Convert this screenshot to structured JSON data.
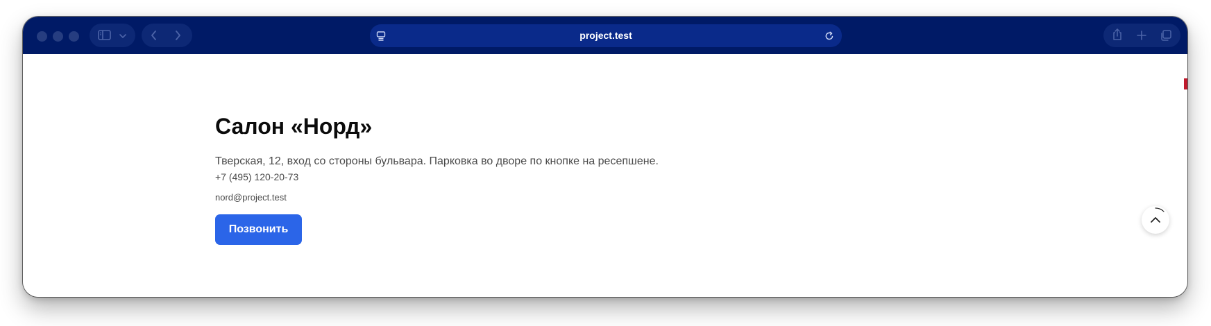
{
  "browser": {
    "url": "project.test",
    "icons": {
      "sidebar": "sidebar-icon",
      "tab_overview": "chevron-down-icon",
      "back": "chevron-left-icon",
      "forward": "chevron-right-icon",
      "reader": "page-menu-icon",
      "reload": "reload-icon",
      "share": "share-icon",
      "new_tab": "plus-icon",
      "tabs": "tabs-icon"
    },
    "colors": {
      "toolbar": "#001a66",
      "address_bar": "#0a2a8a"
    }
  },
  "page": {
    "title": "Салон «Норд»",
    "address": "Тверская, 12, вход со стороны бульвара. Парковка во дворе по кнопке на ресепшене.",
    "phone": "+7 (495) 120-20-73",
    "email": "nord@project.test",
    "call_button": "Позвонить",
    "scroll_top_icon": "chevron-up-icon",
    "colors": {
      "button": "#2b65e8",
      "marker": "#c0192c"
    }
  }
}
